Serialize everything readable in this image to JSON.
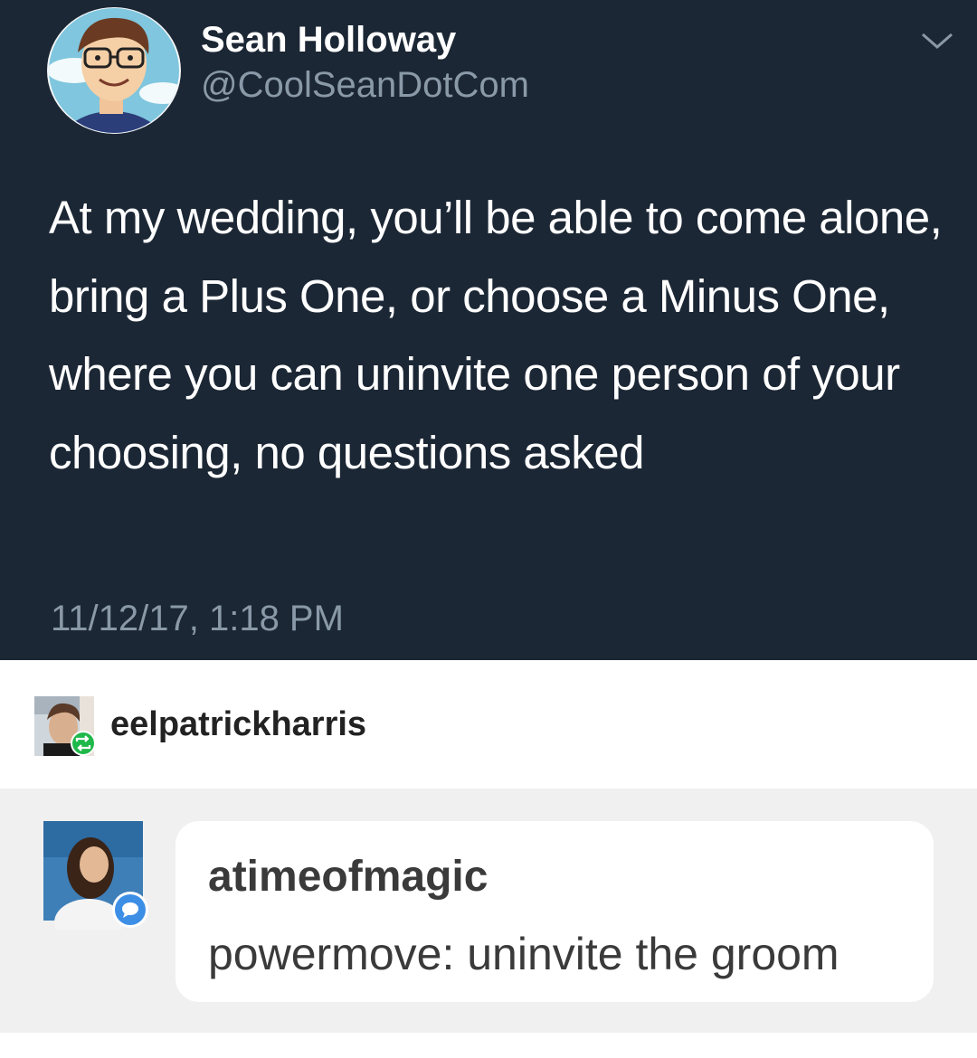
{
  "tweet": {
    "display_name": "Sean Holloway",
    "handle": "@CoolSeanDotCom",
    "text": "At my wedding, you’ll be able to come alone, bring a Plus One, or choose a Minus One, where you can uninvite one person of your choosing, no questions asked",
    "timestamp": "11/12/17, 1:18 PM",
    "avatar_icon": "cartoon-avatar-with-glasses",
    "menu_icon": "chevron-down-icon"
  },
  "reblog": {
    "username": "eelpatrickharris",
    "badge_icon": "reblog-icon",
    "badge_color": "#1fb84a"
  },
  "reply": {
    "username": "atimeofmagic",
    "text": "powermove: uninvite the groom",
    "badge_icon": "speech-bubble-icon",
    "badge_color": "#3d8fe6"
  }
}
